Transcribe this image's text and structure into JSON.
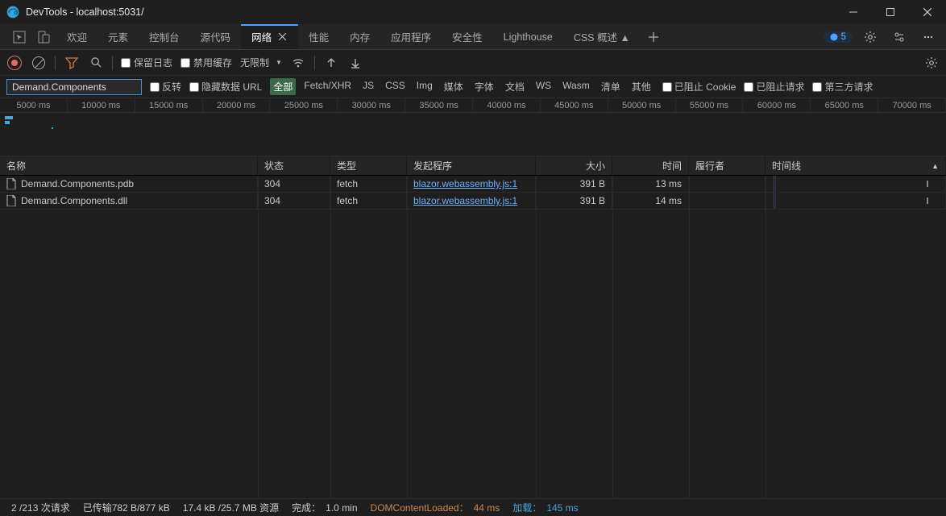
{
  "window": {
    "title": "DevTools - localhost:5031/"
  },
  "tabs": {
    "items": [
      "欢迎",
      "元素",
      "控制台",
      "源代码",
      "网络",
      "性能",
      "内存",
      "应用程序",
      "安全性",
      "Lighthouse",
      "CSS 概述 ▲"
    ],
    "active": "网络",
    "issues_count": "5"
  },
  "toolbar": {
    "preserve_log": "保留日志",
    "disable_cache": "禁用缓存",
    "throttle": "无限制"
  },
  "filterbar": {
    "filter_value": "Demand.Components",
    "invert": "反转",
    "hide_data": "隐藏数据 URL",
    "types": [
      "全部",
      "Fetch/XHR",
      "JS",
      "CSS",
      "Img",
      "媒体",
      "字体",
      "文档",
      "WS",
      "Wasm",
      "清单",
      "其他"
    ],
    "active_type": "全部",
    "blocked_cookies": "已阻止 Cookie",
    "blocked_requests": "已阻止请求",
    "thirdparty": "第三方请求"
  },
  "timeline": {
    "ticks": [
      "5000 ms",
      "10000 ms",
      "15000 ms",
      "20000 ms",
      "25000 ms",
      "30000 ms",
      "35000 ms",
      "40000 ms",
      "45000 ms",
      "50000 ms",
      "55000 ms",
      "60000 ms",
      "65000 ms",
      "70000 ms"
    ]
  },
  "table": {
    "headers": {
      "name": "名称",
      "status": "状态",
      "type": "类型",
      "initiator": "发起程序",
      "size": "大小",
      "time": "时间",
      "actor": "履行者",
      "waterfall": "时间线"
    },
    "rows": [
      {
        "name": "Demand.Components.pdb",
        "status": "304",
        "type": "fetch",
        "initiator": "blazor.webassembly.js:1",
        "size": "391 B",
        "time": "13 ms"
      },
      {
        "name": "Demand.Components.dll",
        "status": "304",
        "type": "fetch",
        "initiator": "blazor.webassembly.js:1",
        "size": "391 B",
        "time": "14 ms"
      }
    ]
  },
  "status": {
    "requests": "2 /213 次请求",
    "transferred": "已传输782 B/877 kB",
    "resources": "17.4 kB /25.7 MB 资源",
    "finish_label": "完成：",
    "finish": "1.0 min",
    "dcl_label": "DOMContentLoaded：",
    "dcl": "44 ms",
    "load_label": "加载：",
    "load": "145 ms"
  }
}
